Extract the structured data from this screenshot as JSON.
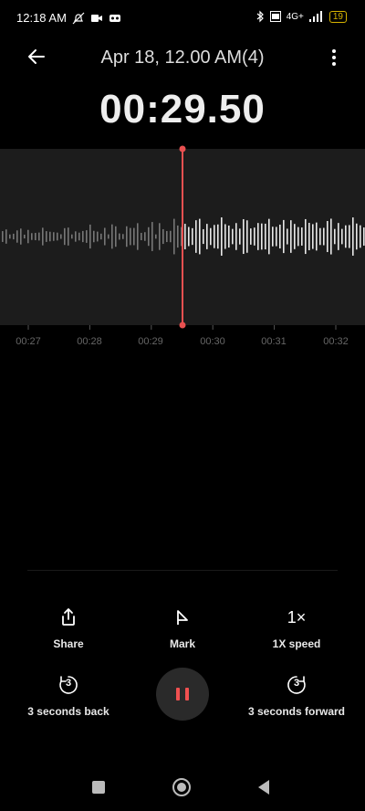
{
  "status": {
    "time": "12:18 AM",
    "battery": "19",
    "network": "4G+"
  },
  "header": {
    "title": "Apr 18, 12.00 AM(4)"
  },
  "timer": "00:29.50",
  "timeline": {
    "ticks": [
      "00:27",
      "00:28",
      "00:29",
      "00:30",
      "00:31",
      "00:32"
    ]
  },
  "controls": {
    "share": "Share",
    "mark": "Mark",
    "speed_icon": "1×",
    "speed": "1X speed",
    "back_icon": "3",
    "back": "3 seconds back",
    "forward_icon": "3",
    "forward": "3 seconds forward"
  },
  "colors": {
    "playhead": "#e85050",
    "pause": "#f05050"
  }
}
